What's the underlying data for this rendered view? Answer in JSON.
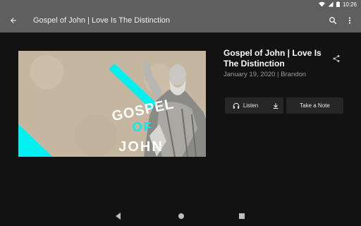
{
  "status_bar": {
    "time": "10:26",
    "icons": [
      "wifi-icon",
      "signal-icon",
      "battery-icon"
    ]
  },
  "app_bar": {
    "title": "Gospel of John | Love Is The Distinction",
    "icons": [
      "back-arrow-icon",
      "search-icon",
      "more-vert-icon"
    ]
  },
  "sermon": {
    "title": "Gospel of John | Love Is The Distinction",
    "meta": "January 19, 2020 | Brandon",
    "artwork_text": {
      "line1": "GOSPEL",
      "line2": "OF",
      "line3": "JOHN"
    },
    "artwork_colors": {
      "paper": "#c6b7a0",
      "accent": "#00f0f0"
    }
  },
  "actions": {
    "listen_label": "Listen",
    "note_label": "Take a Note",
    "icons": [
      "headphones-icon",
      "download-icon",
      "share-icon"
    ]
  },
  "nav_bar": {
    "icons": [
      "nav-back-icon",
      "nav-home-icon",
      "nav-recents-icon"
    ]
  }
}
